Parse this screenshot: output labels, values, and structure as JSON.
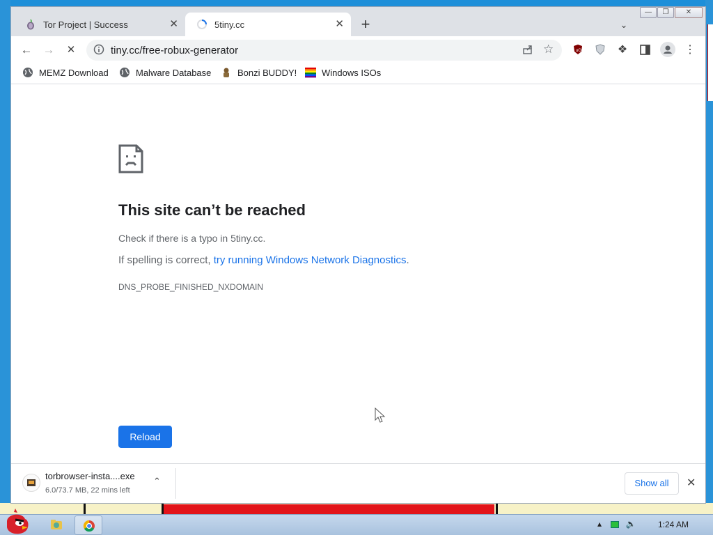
{
  "tabs": [
    {
      "title": "Tor Project | Success",
      "icon": "tor-onion-icon",
      "active": false
    },
    {
      "title": "5tiny.cc",
      "icon": "loading-spinner-icon",
      "active": true
    }
  ],
  "toolbar": {
    "url": "tiny.cc/free-robux-generator"
  },
  "bookmarks": [
    {
      "label": "MEMZ Download",
      "icon": "globe-icon"
    },
    {
      "label": "Malware Database",
      "icon": "globe-icon"
    },
    {
      "label": "Bonzi BUDDY!",
      "icon": "bonzi-icon"
    },
    {
      "label": "Windows ISOs",
      "icon": "rainbow-flag-icon"
    }
  ],
  "error": {
    "title": "This site can’t be reached",
    "check_line": "Check if there is a typo in 5tiny.cc.",
    "spelling_prefix": "If spelling is correct, ",
    "spelling_link": "try running Windows Network Diagnostics",
    "spelling_suffix": ".",
    "code": "DNS_PROBE_FINISHED_NXDOMAIN",
    "reload_label": "Reload"
  },
  "download": {
    "filename": "torbrowser-insta....exe",
    "status": "6.0/73.7 MB, 22 mins left",
    "show_all_label": "Show all"
  },
  "taskbar": {
    "time": "1:24 AM"
  },
  "colors": {
    "accent": "#1a73e8",
    "desktop": "#1e8fd9"
  }
}
